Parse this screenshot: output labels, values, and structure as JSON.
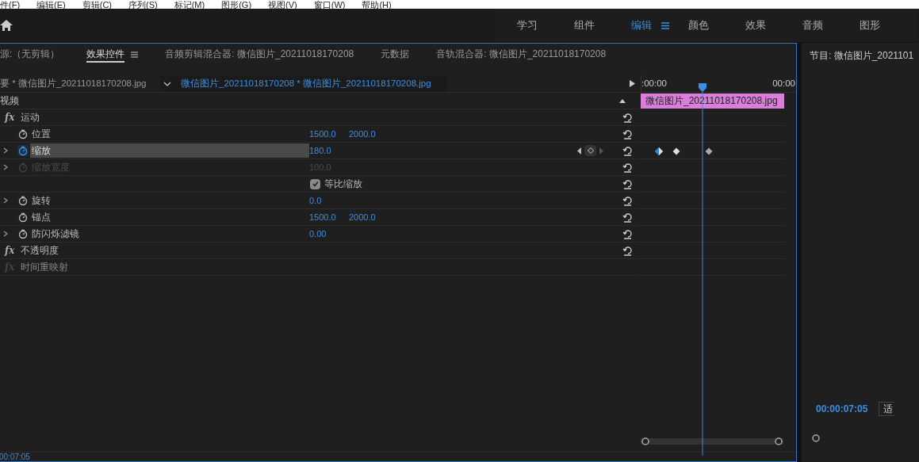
{
  "menu": [
    "件(F)",
    "编辑(E)",
    "剪辑(C)",
    "序列(S)",
    "标记(M)",
    "图形(G)",
    "视图(V)",
    "窗口(W)",
    "帮助(H)"
  ],
  "workspaces": [
    {
      "label": "学习",
      "selected": false
    },
    {
      "label": "组件",
      "selected": false
    },
    {
      "label": "编辑",
      "selected": true
    },
    {
      "label": "颜色",
      "selected": false
    },
    {
      "label": "效果",
      "selected": false
    },
    {
      "label": "音频",
      "selected": false
    },
    {
      "label": "图形",
      "selected": false
    }
  ],
  "panel_tabs": [
    {
      "label": "源:（无剪辑）",
      "selected": false
    },
    {
      "label": "效果控件",
      "selected": true
    },
    {
      "label": "音频剪辑混合器: 微信图片_20211018170208",
      "selected": false
    },
    {
      "label": "元数据",
      "selected": false
    },
    {
      "label": "音轨混合器: 微信图片_20211018170208",
      "selected": false
    }
  ],
  "clip_selector": {
    "master": "要 * 微信图片_20211018170208.jpg",
    "sequence": "微信图片_20211018170208 * 微信图片_20211018170208.jpg"
  },
  "ruler": {
    "start": ":00:00",
    "end": "00:00"
  },
  "clip_bar": "微信图片_20211018170208.jpg",
  "effects": [
    {
      "kind": "section",
      "label": "视频"
    },
    {
      "kind": "effect",
      "icon_text": "fx",
      "label": "运动",
      "disabled": false
    },
    {
      "kind": "property",
      "label": "位置",
      "values": [
        "1500.0",
        "2000.0"
      ],
      "expandable": false,
      "animated": false,
      "selected": false,
      "disabled": false
    },
    {
      "kind": "property",
      "label": "缩放",
      "values": [
        "180.0"
      ],
      "expandable": true,
      "animated": true,
      "selected": true,
      "disabled": false
    },
    {
      "kind": "property",
      "label": "缩放宽度",
      "values": [
        "100.0"
      ],
      "expandable": true,
      "animated": false,
      "selected": false,
      "disabled": true
    },
    {
      "kind": "checkbox",
      "label": "等比缩放",
      "checked": true
    },
    {
      "kind": "property",
      "label": "旋转",
      "values": [
        "0.0"
      ],
      "expandable": true,
      "animated": false,
      "selected": false,
      "disabled": false
    },
    {
      "kind": "property",
      "label": "锚点",
      "values": [
        "1500.0",
        "2000.0"
      ],
      "expandable": false,
      "animated": false,
      "selected": false,
      "disabled": false
    },
    {
      "kind": "property",
      "label": "防闪烁滤镜",
      "values": [
        "0.00"
      ],
      "expandable": true,
      "animated": false,
      "selected": false,
      "disabled": false
    },
    {
      "kind": "effect",
      "icon_text": "fx",
      "label": "不透明度",
      "disabled": false
    },
    {
      "kind": "effect",
      "icon_text": "fx",
      "label": "时间重映射",
      "disabled": true
    }
  ],
  "timecode": "00:07:05",
  "program": {
    "title": "节目: 微信图片_2021101",
    "timecode": "00:00:07:05",
    "zoom": "适"
  }
}
